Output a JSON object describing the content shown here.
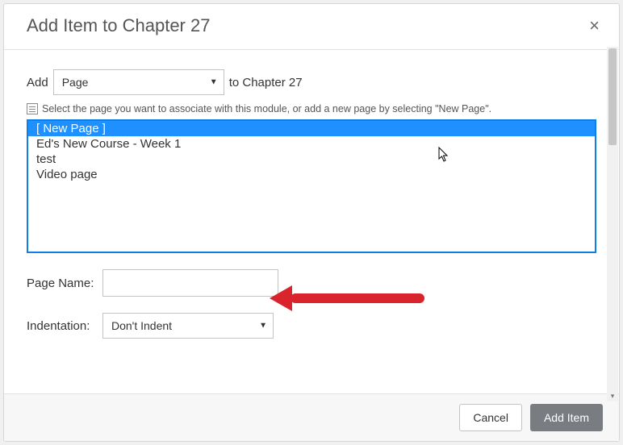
{
  "header": {
    "title": "Add Item to Chapter 27",
    "close_label": "×"
  },
  "add_row": {
    "prefix": "Add",
    "type_options": [
      "Page"
    ],
    "type_selected": "Page",
    "suffix": "to Chapter 27"
  },
  "hint_text": "Select the page you want to associate with this module, or add a new page by selecting \"New Page\".",
  "page_list": {
    "options": [
      {
        "label": "[ New Page ]",
        "selected": true
      },
      {
        "label": "Ed's New Course - Week 1",
        "selected": false
      },
      {
        "label": "test",
        "selected": false
      },
      {
        "label": "Video page",
        "selected": false
      }
    ]
  },
  "page_name": {
    "label": "Page Name:",
    "value": ""
  },
  "indentation": {
    "label": "Indentation:",
    "options": [
      "Don't Indent"
    ],
    "selected": "Don't Indent"
  },
  "footer": {
    "cancel": "Cancel",
    "submit": "Add Item"
  }
}
